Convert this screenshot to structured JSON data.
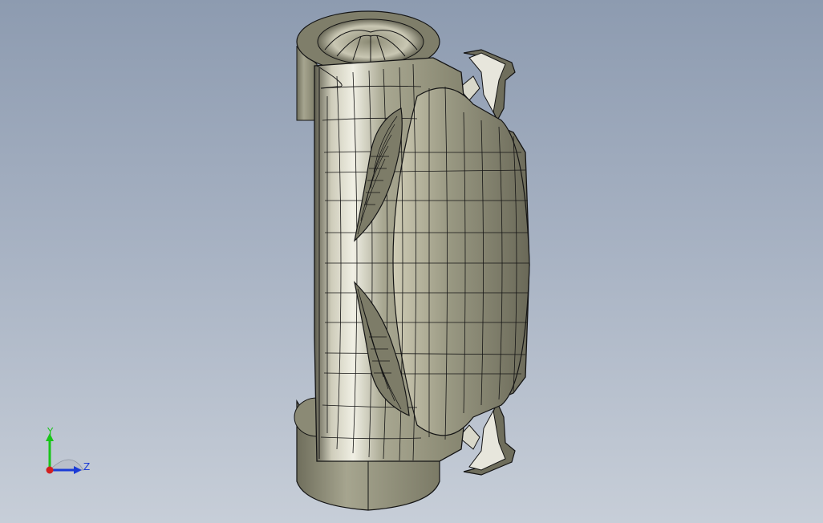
{
  "viewport": {
    "background_top": "#8d9bb0",
    "background_bottom": "#c7ced8",
    "model": {
      "body_color": "#8e8d77",
      "body_light": "#d7d6c6",
      "body_dark": "#5e5d4e",
      "edge_color": "#141414"
    }
  },
  "triad": {
    "y_label": "Y",
    "z_label": "Z",
    "y_color": "#19c519",
    "z_color": "#1b3bd6",
    "x_color": "#d22020"
  }
}
